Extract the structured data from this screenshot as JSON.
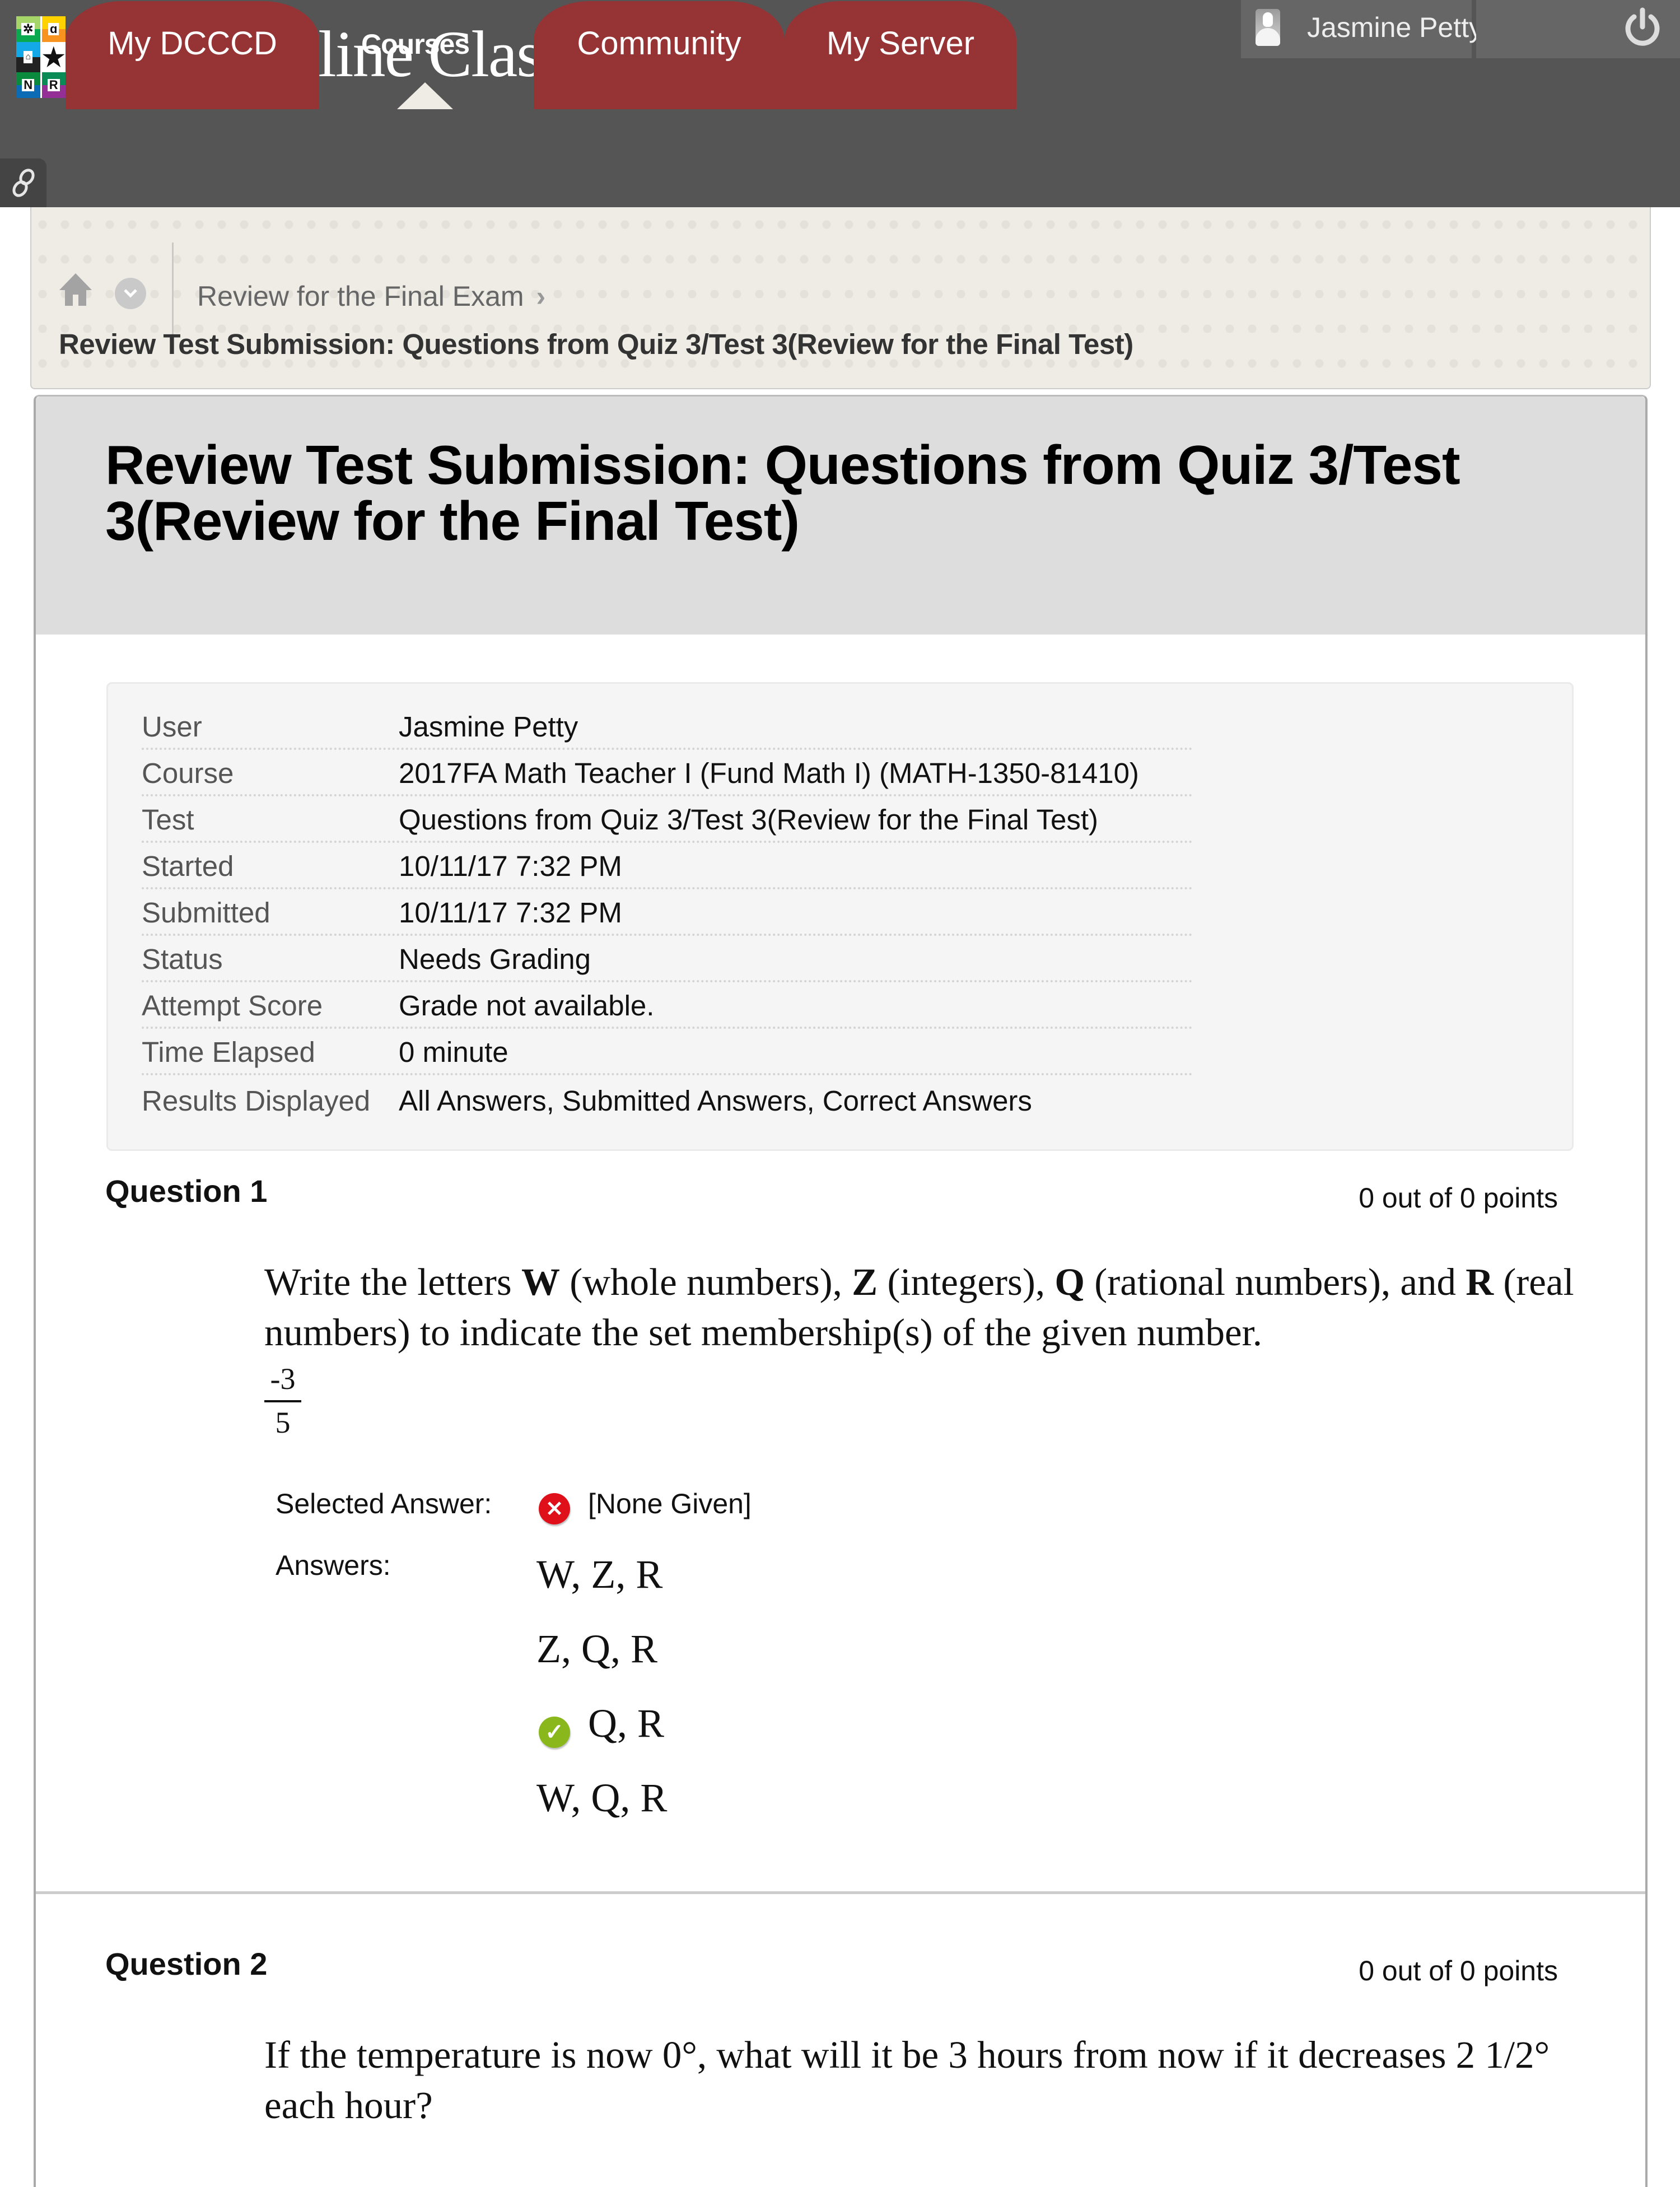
{
  "topbar": {
    "logo_icon": "college-logo-grid",
    "banner_text": "line Clas",
    "tabs": [
      {
        "label": "My DCCCD"
      },
      {
        "label": "Courses",
        "active": true
      },
      {
        "label": "Community"
      },
      {
        "label": "My Server"
      }
    ],
    "user": {
      "name": "Jasmine Petty",
      "avatar_icon": "avatar-silhouette-icon",
      "menu_icon": "caret-down-icon"
    },
    "logout_icon": "power-icon",
    "quicklinks_icon": "link-icon",
    "colors": {
      "bar": "#555555",
      "tab": "#963334"
    }
  },
  "breadcrumb": {
    "home_icon": "home-icon",
    "menu_icon": "chevron-down-circle-icon",
    "items": [
      {
        "label": "Review for the Final Exam"
      },
      {
        "label": "Review Test Submission: Questions from Quiz 3/Test 3(Review for the Final Test)"
      }
    ]
  },
  "page": {
    "title": "Review Test Submission: Questions from Quiz 3/Test 3(Review for the Final Test)"
  },
  "submission_info": [
    {
      "label": "User",
      "value": "Jasmine Petty"
    },
    {
      "label": "Course",
      "value": "2017FA Math Teacher I (Fund Math I) (MATH-1350-81410)"
    },
    {
      "label": "Test",
      "value": "Questions from Quiz 3/Test 3(Review for the Final Test)"
    },
    {
      "label": "Started",
      "value": "10/11/17 7:32 PM"
    },
    {
      "label": "Submitted",
      "value": "10/11/17 7:32 PM"
    },
    {
      "label": "Status",
      "value": "Needs Grading"
    },
    {
      "label": "Attempt Score",
      "value": "Grade not available."
    },
    {
      "label": "Time Elapsed",
      "value": "0 minute"
    },
    {
      "label": "Results Displayed",
      "value": "All Answers, Submitted Answers, Correct Answers"
    }
  ],
  "questions": [
    {
      "title": "Question 1",
      "points": "0 out of 0 points",
      "text_parts": {
        "p1": "Write the letters ",
        "b1": "W",
        "p2": " (whole numbers), ",
        "b2": "Z",
        "p3": " (integers), ",
        "b3": "Q",
        "p4": " (rational numbers), and ",
        "b4": "R",
        "p5": " (real numbers) to indicate the set membership(s) of the given number."
      },
      "fraction": {
        "numerator": "-3",
        "denominator": "5"
      },
      "selected_answer_label": "Selected Answer:",
      "selected_answer": "[None Given]",
      "selected_status_icon": "incorrect-x-icon",
      "answers_label": "Answers:",
      "answers": [
        {
          "text": "W, Z, R",
          "correct": false
        },
        {
          "text": "Z, Q, R",
          "correct": false
        },
        {
          "text": "Q, R",
          "correct": true,
          "icon": "correct-check-icon"
        },
        {
          "text": "W, Q, R",
          "correct": false
        }
      ]
    },
    {
      "title": "Question 2",
      "points": "0 out of 0 points",
      "text": "If the temperature is now 0°, what will it be 3 hours from now if it decreases 2 1/2° each hour?"
    }
  ],
  "glyphs": {
    "x": "✕",
    "check": "✓",
    "chevron": "›"
  }
}
